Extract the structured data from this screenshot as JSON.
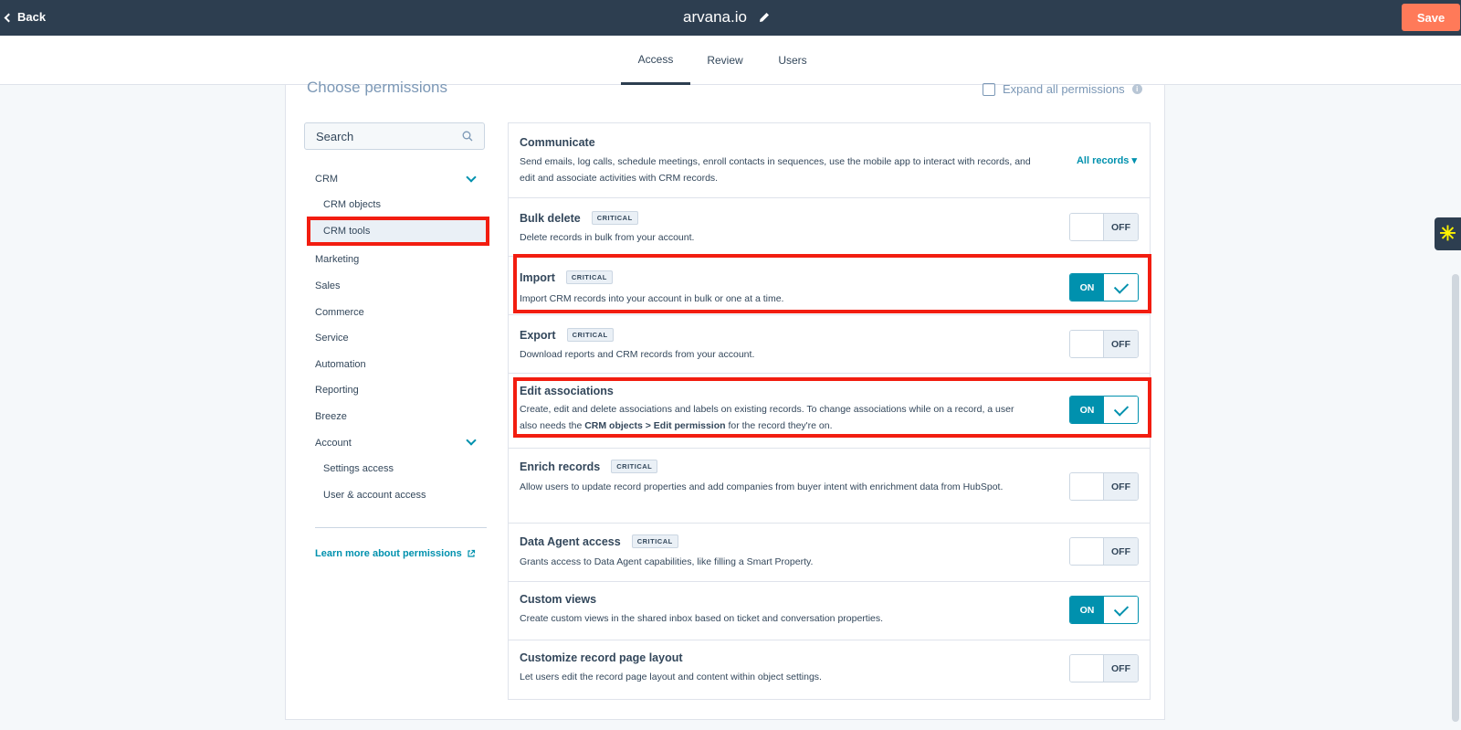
{
  "header": {
    "back_label": "Back",
    "app_title": "arvana.io",
    "save_label": "Save"
  },
  "tabs": [
    {
      "label": "Access",
      "active": true
    },
    {
      "label": "Review",
      "active": false
    },
    {
      "label": "Users",
      "active": false
    }
  ],
  "panel": {
    "heading": "Choose permissions",
    "expand_label": "Expand all permissions"
  },
  "sidebar": {
    "search_placeholder": "Search",
    "items": [
      {
        "label": "CRM",
        "expanded": true
      },
      {
        "label": "CRM objects"
      },
      {
        "label": "CRM tools",
        "selected": true
      },
      {
        "label": "Marketing"
      },
      {
        "label": "Sales"
      },
      {
        "label": "Commerce"
      },
      {
        "label": "Service"
      },
      {
        "label": "Automation"
      },
      {
        "label": "Reporting"
      },
      {
        "label": "Breeze"
      },
      {
        "label": "Account",
        "expanded": true
      },
      {
        "label": "Settings access"
      },
      {
        "label": "User & account access"
      }
    ],
    "learn_more": "Learn more about permissions"
  },
  "permissions": [
    {
      "title": "Communicate",
      "critical": false,
      "desc": "Send emails, log calls, schedule meetings, enroll contacts in sequences, use the mobile app to interact with records, and edit and associate activities with CRM records.",
      "scope": "All records"
    },
    {
      "title": "Bulk delete",
      "critical": true,
      "badge": "CRITICAL",
      "desc": "Delete records in bulk from your account.",
      "state": "OFF"
    },
    {
      "title": "Import",
      "critical": true,
      "badge": "CRITICAL",
      "desc": "Import CRM records into your account in bulk or one at a time.",
      "state": "ON"
    },
    {
      "title": "Export",
      "critical": true,
      "badge": "CRITICAL",
      "desc": "Download reports and CRM records from your account.",
      "state": "OFF"
    },
    {
      "title": "Edit associations",
      "critical": false,
      "desc_before": "Create, edit and delete associations and labels on existing records. To change associations while on a record, a user also needs the ",
      "desc_bold": "CRM objects > Edit permission",
      "desc_after": " for the record they're on.",
      "state": "ON"
    },
    {
      "title": "Enrich records",
      "critical": true,
      "badge": "CRITICAL",
      "desc": "Allow users to update record properties and add companies from buyer intent with enrichment data from HubSpot.",
      "state": "OFF"
    },
    {
      "title": "Data Agent access",
      "critical": true,
      "badge": "CRITICAL",
      "desc": "Grants access to Data Agent capabilities, like filling a Smart Property.",
      "state": "OFF"
    },
    {
      "title": "Custom views",
      "critical": false,
      "desc": "Create custom views in the shared inbox based on ticket and conversation properties.",
      "state": "ON"
    },
    {
      "title": "Customize record page layout",
      "critical": false,
      "desc": "Let users edit the record page layout and content within object settings.",
      "state": "OFF"
    }
  ],
  "colors": {
    "header_bg": "#2d3e50",
    "save_bg": "#ff7a59",
    "accent": "#0091ae",
    "highlight": "#f21d10"
  }
}
